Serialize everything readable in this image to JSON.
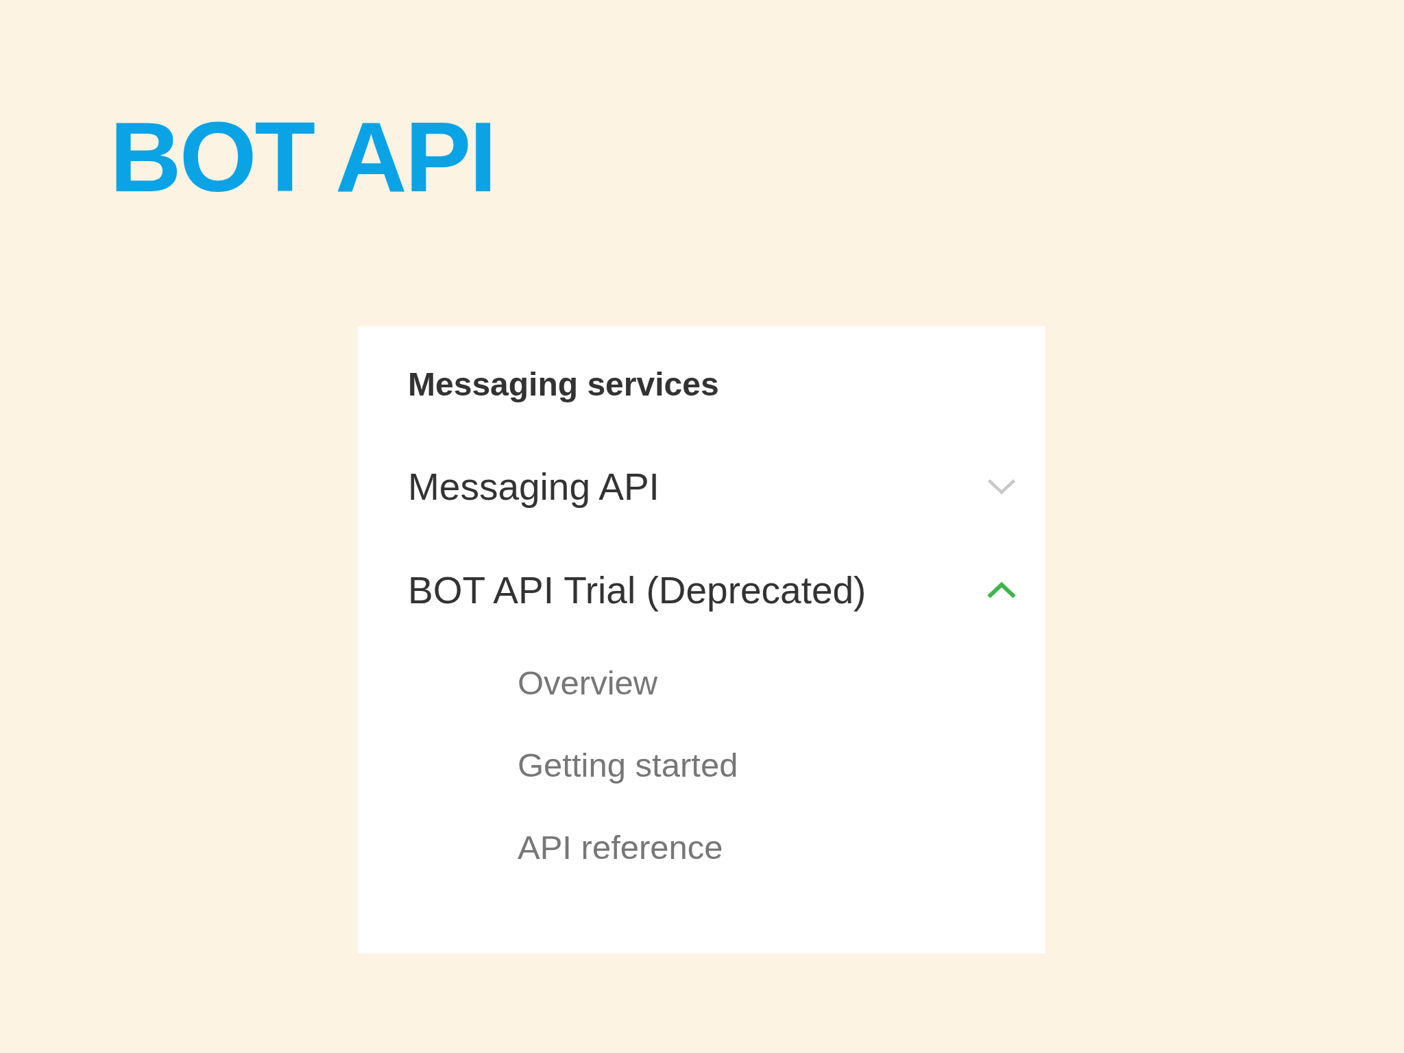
{
  "slide_title": "BOT API",
  "menu": {
    "heading": "Messaging services",
    "items": [
      {
        "label": "Messaging API",
        "expanded": false
      },
      {
        "label": "BOT API Trial (Deprecated)",
        "expanded": true,
        "children": [
          {
            "label": "Overview"
          },
          {
            "label": "Getting started"
          },
          {
            "label": "API reference"
          }
        ]
      }
    ]
  }
}
